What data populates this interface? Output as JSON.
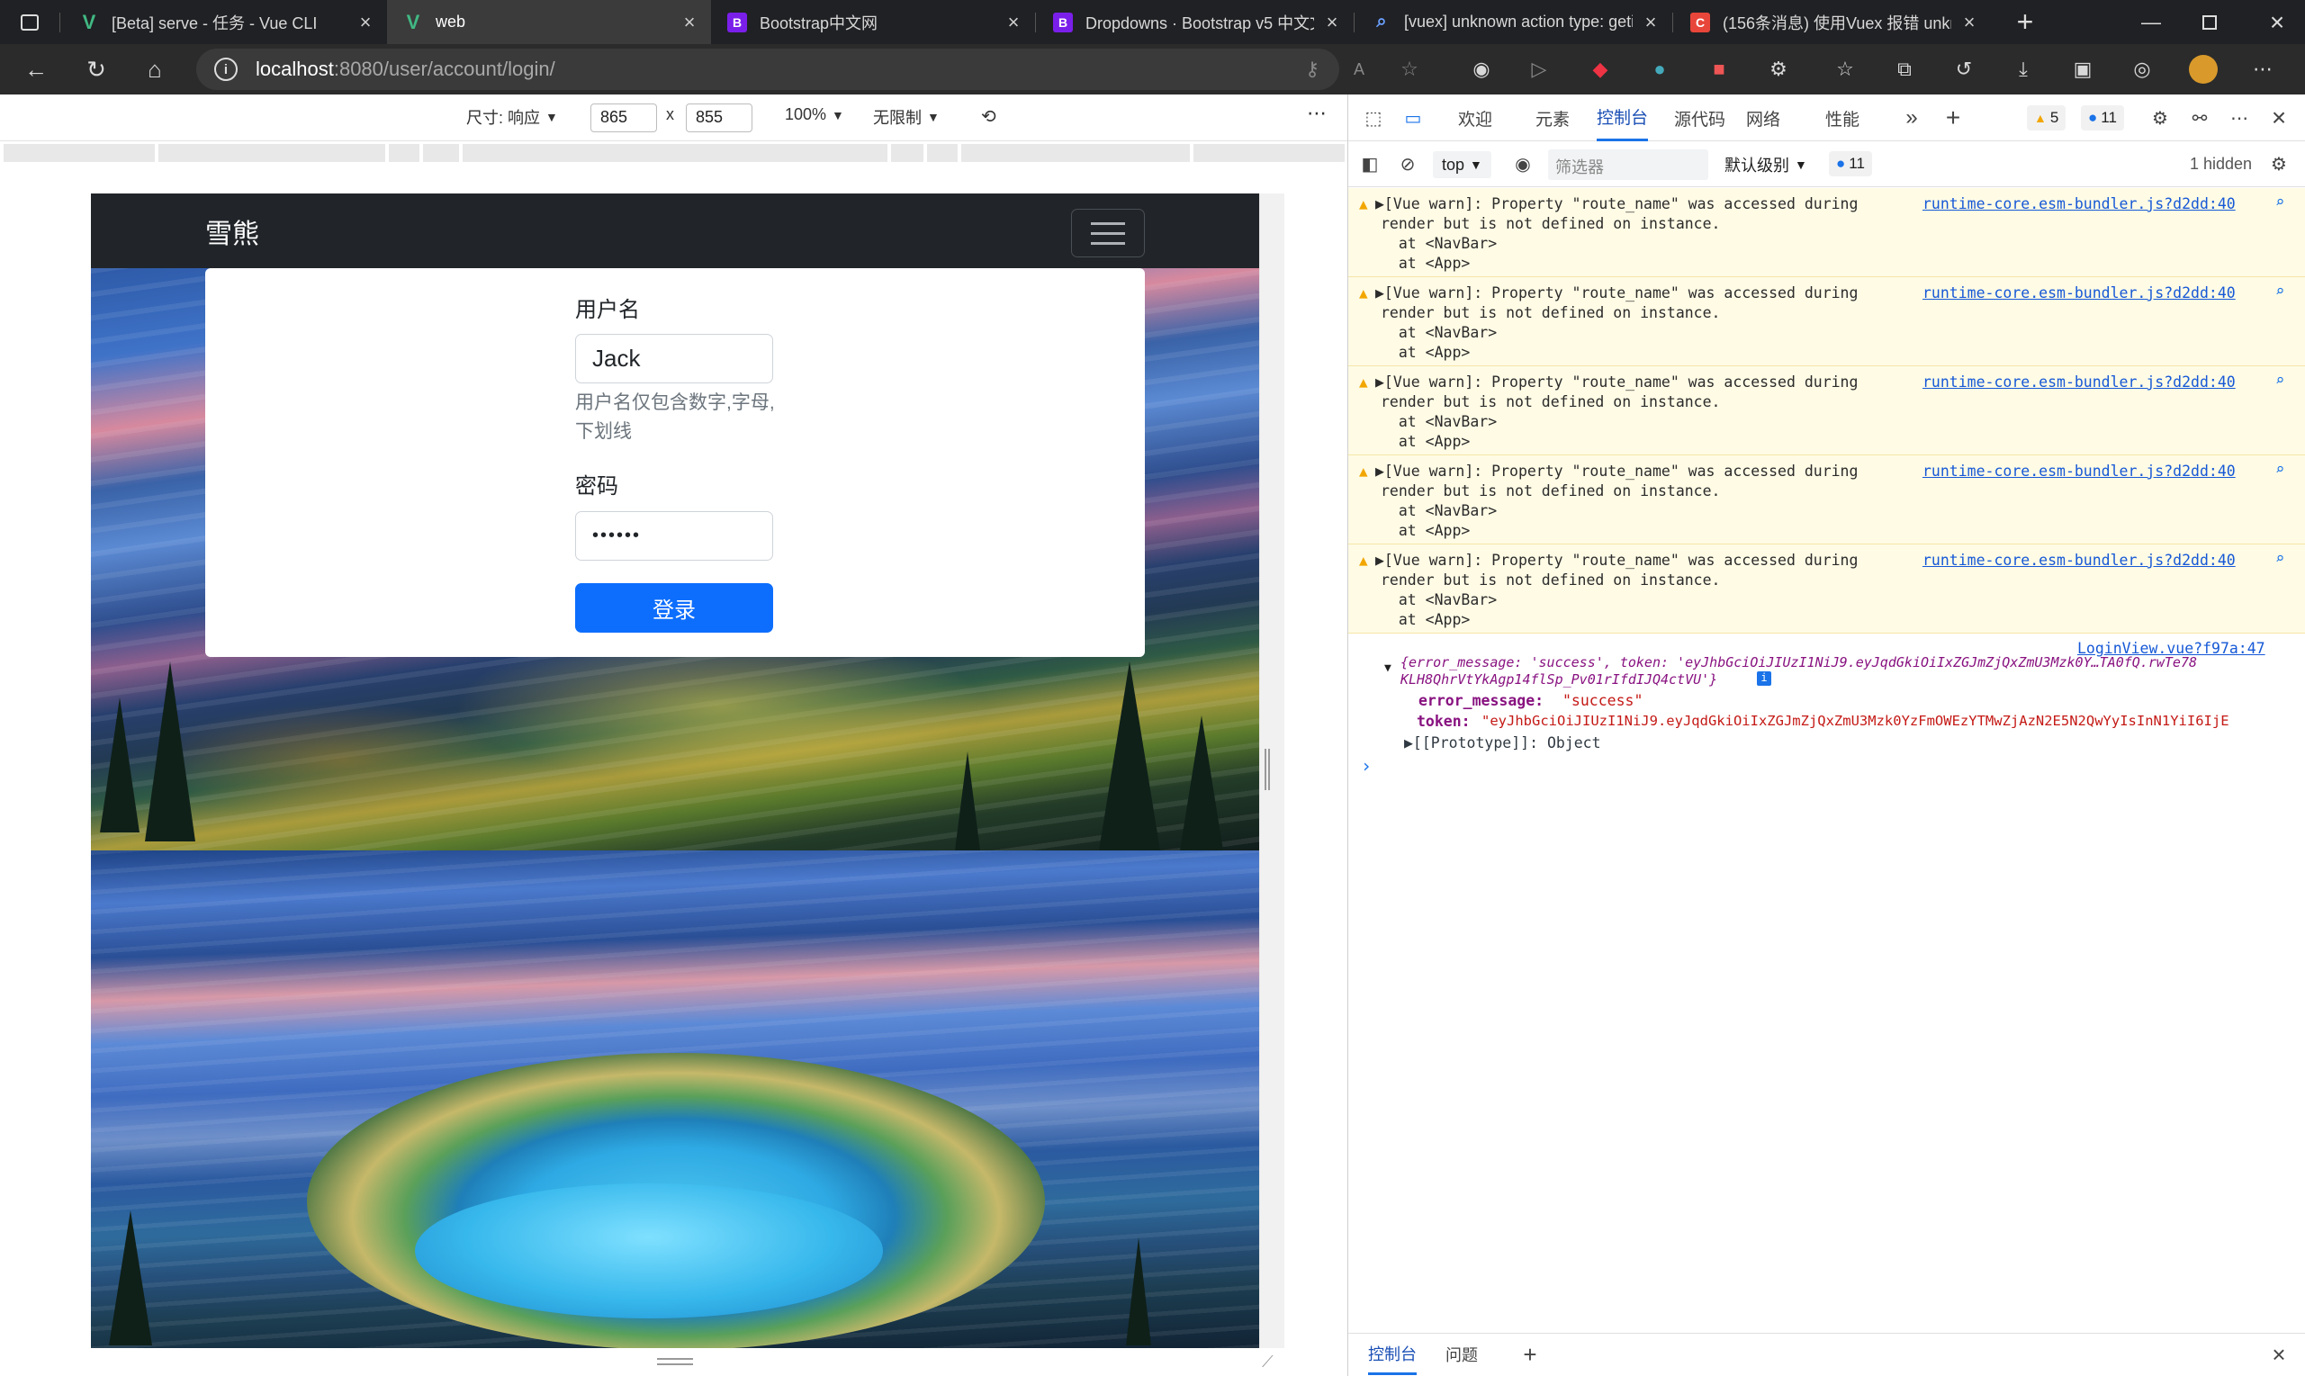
{
  "browser": {
    "tabs": [
      {
        "title": "[Beta] serve - 任务 - Vue CLI",
        "favicon": "vue-icon"
      },
      {
        "title": "web",
        "favicon": "vue-icon",
        "active": true
      },
      {
        "title": "Bootstrap中文网",
        "favicon": "bootstrap-icon"
      },
      {
        "title": "Dropdowns · Bootstrap v5 中文文",
        "favicon": "bootstrap-icon"
      },
      {
        "title": "[vuex] unknown action type: geti",
        "favicon": "search-icon"
      },
      {
        "title": "(156条消息) 使用Vuex 报错 unkn",
        "favicon": "csdn-icon"
      }
    ],
    "url_host": "localhost",
    "url_path": ":8080/user/account/login/"
  },
  "device_toolbar": {
    "size_label": "尺寸: 响应",
    "width": "865",
    "x": "x",
    "height": "855",
    "zoom": "100%",
    "throttle": "无限制"
  },
  "app": {
    "brand": "雪熊",
    "form": {
      "username_label": "用户名",
      "username_value": "Jack",
      "username_help": "用户名仅包含数字,字母,下划线",
      "password_label": "密码",
      "password_value": "••••••",
      "login_button": "登录"
    }
  },
  "devtools": {
    "tabs": [
      "欢迎",
      "元素",
      "控制台",
      "源代码",
      "网络",
      "性能"
    ],
    "active_tab": "控制台",
    "warn_count": "5",
    "msg_count": "11",
    "context": "top",
    "filter_placeholder": "筛选器",
    "level": "默认级别",
    "issues_count": "11",
    "hidden": "1 hidden",
    "warnings": [
      {
        "line1": "▶[Vue warn]: Property \"route_name\" was accessed during",
        "line2": "render but is not defined on instance.",
        "line3": "  at <NavBar>",
        "line4": "  at <App>",
        "source": "runtime-core.esm-bundler.js?d2dd:40"
      },
      {
        "line1": "▶[Vue warn]: Property \"route_name\" was accessed during",
        "line2": "render but is not defined on instance.",
        "line3": "  at <NavBar>",
        "line4": "  at <App>",
        "source": "runtime-core.esm-bundler.js?d2dd:40"
      },
      {
        "line1": "▶[Vue warn]: Property \"route_name\" was accessed during",
        "line2": "render but is not defined on instance.",
        "line3": "  at <NavBar>",
        "line4": "  at <App>",
        "source": "runtime-core.esm-bundler.js?d2dd:40"
      },
      {
        "line1": "▶[Vue warn]: Property \"route_name\" was accessed during",
        "line2": "render but is not defined on instance.",
        "line3": "  at <NavBar>",
        "line4": "  at <App>",
        "source": "runtime-core.esm-bundler.js?d2dd:40"
      },
      {
        "line1": "▶[Vue warn]: Property \"route_name\" was accessed during",
        "line2": "render but is not defined on instance.",
        "line3": "  at <NavBar>",
        "line4": "  at <App>",
        "source": "runtime-core.esm-bundler.js?d2dd:40"
      }
    ],
    "log": {
      "source": "LoginView.vue?f97a:47",
      "summary1": "{error_message: 'success', token: 'eyJhbGciOiJIUzI1NiJ9.eyJqdGkiOiIxZGJmZjQxZmU3Mzk0Y…TA0fQ.rwTe78",
      "summary2": "KLH8QhrVtYkAgp14flSp_Pv01rIfdIJQ4ctVU'}",
      "prop1_key": "error_message:",
      "prop1_val": "\"success\"",
      "prop2_key": "token:",
      "prop2_val": "\"eyJhbGciOiJIUzI1NiJ9.eyJqdGkiOiIxZGJmZjQxZmU3Mzk0YzFmOWEzYTMwZjAzN2E5N2QwYyIsInN1YiI6IjE",
      "proto": "▶[[Prototype]]: Object",
      "prompt": "›"
    },
    "drawer_tabs": [
      "控制台",
      "问题"
    ]
  }
}
